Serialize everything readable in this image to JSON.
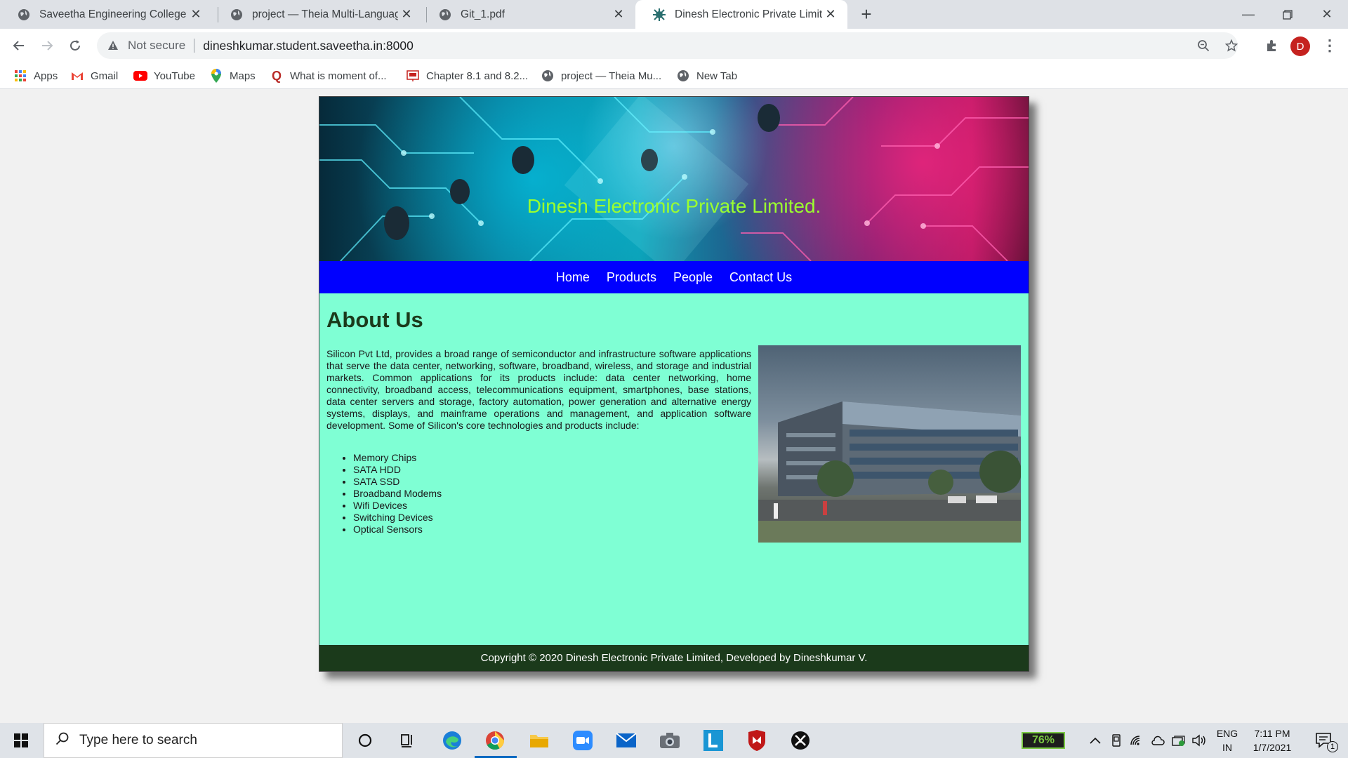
{
  "browser": {
    "tabs": [
      {
        "title": "Saveetha Engineering College",
        "icon": "globe-icon"
      },
      {
        "title": "project — Theia Multi-Language",
        "icon": "globe-icon"
      },
      {
        "title": "Git_1.pdf",
        "icon": "globe-icon"
      },
      {
        "title": "Dinesh Electronic Private Limited",
        "icon": "chip-icon",
        "active": true
      }
    ],
    "address": {
      "security_label": "Not secure",
      "url": "dineshkumar.student.saveetha.in:8000"
    },
    "profile_initial": "D",
    "bookmarks": [
      {
        "label": "Apps",
        "icon": "apps-grid-icon"
      },
      {
        "label": "Gmail",
        "icon": "gmail-icon"
      },
      {
        "label": "YouTube",
        "icon": "youtube-icon"
      },
      {
        "label": "Maps",
        "icon": "maps-icon"
      },
      {
        "label": "What is moment of...",
        "icon": "quora-icon"
      },
      {
        "label": "Chapter 8.1 and 8.2...",
        "icon": "slides-icon"
      },
      {
        "label": "project — Theia Mu...",
        "icon": "globe-icon"
      },
      {
        "label": "New Tab",
        "icon": "globe-icon"
      }
    ]
  },
  "site": {
    "banner_title": "Dinesh Electronic Private Limited.",
    "nav": [
      "Home",
      "Products",
      "People",
      "Contact Us"
    ],
    "heading": "About Us",
    "about_text": "Silicon Pvt Ltd, provides a broad range of semiconductor and infrastructure software applications that serve the data center, networking, software, broadband, wireless, and storage and industrial markets. Common applications for its products include: data center networking, home connectivity, broadband access, telecommunications equipment, smartphones, base stations, data center servers and storage, factory automation, power generation and alternative energy systems, displays, and mainframe operations and management, and application software development. Some of Silicon's core technologies and products include:",
    "products": [
      "Memory Chips",
      "SATA HDD",
      "SATA SSD",
      "Broadband Modems",
      "Wifi Devices",
      "Switching Devices",
      "Optical Sensors"
    ],
    "footer": "Copyright © 2020 Dinesh Electronic Private Limited, Developed by Dineshkumar V.",
    "colors": {
      "nav_bg": "#0000ff",
      "content_bg": "#7fffd4",
      "footer_bg": "#1b3a1b",
      "title_color": "#9bff2f"
    }
  },
  "taskbar": {
    "search_placeholder": "Type here to search",
    "battery": "76%",
    "language": "ENG",
    "region": "IN",
    "time": "7:11 PM",
    "date": "1/7/2021",
    "notification_count": "1"
  }
}
